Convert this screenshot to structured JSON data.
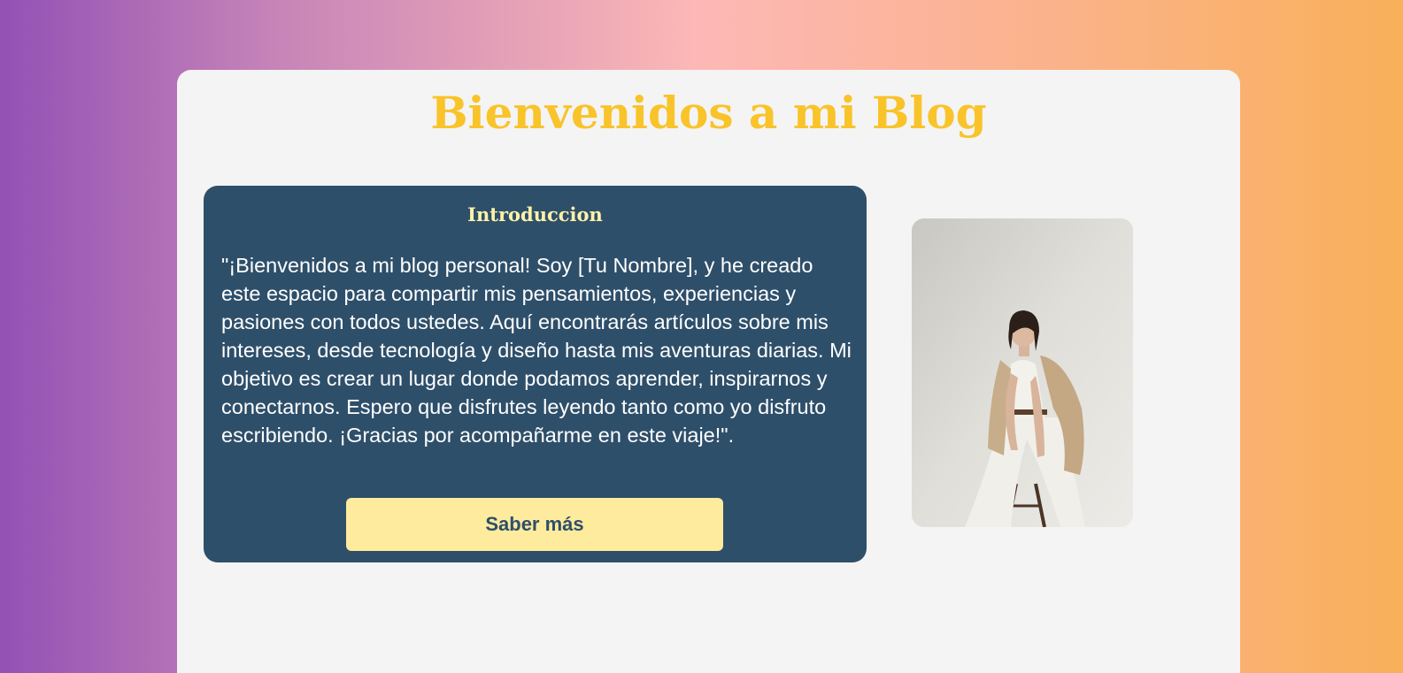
{
  "page": {
    "title": "Bienvenidos a mi Blog"
  },
  "intro": {
    "heading": "Introduccion",
    "text": "\"¡Bienvenidos a mi blog personal! Soy [Tu Nombre], y he creado este espacio para compartir mis pensamientos, experiencias y pasiones con todos ustedes. Aquí encontrarás artículos sobre mis intereses, desde tecnología y diseño hasta mis aventuras diarias. Mi objetivo es crear un lugar donde podamos aprender, inspirarnos y conectarnos. Espero que disfrutes leyendo tanto como yo disfruto escribiendo. ¡Gracias por acompañarme en este viaje!\".",
    "button_label": "Saber más"
  },
  "colors": {
    "title": "#f9c32a",
    "card_background": "#2e4f6a",
    "card_heading": "#fdf2a8",
    "button_background": "#feeb9d",
    "container_background": "#f4f4f4"
  },
  "image": {
    "icon": "photo-woman-seated-on-stool"
  }
}
